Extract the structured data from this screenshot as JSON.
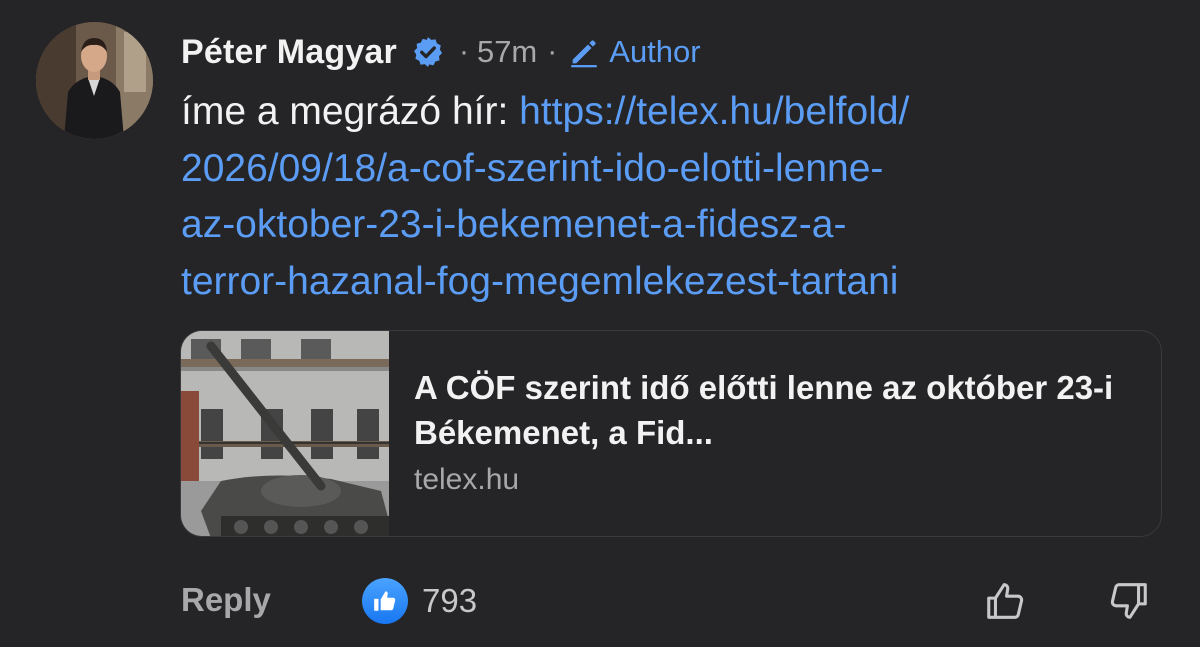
{
  "comment": {
    "author": "Péter Magyar",
    "verified": true,
    "time": "57m",
    "separator": "·",
    "badge_label": "Author",
    "text_prefix": "íme a megrázó hír: ",
    "link_lines": [
      "https://telex.hu/belfold/",
      "2026/09/18/a-cof-szerint-ido-elotti-lenne-",
      "az-oktober-23-i-bekemenet-a-fidesz-a-",
      "terror-hazanal-fog-megemlekezest-tartani"
    ]
  },
  "preview": {
    "title": "A CÖF szerint idő előtti lenne az október 23-i Békemenet, a Fid...",
    "domain": "telex.hu"
  },
  "actions": {
    "reply_label": "Reply",
    "like_count": "793"
  },
  "icons": {
    "verified": "verified-badge-icon",
    "author": "pencil-icon",
    "like": "thumbs-up-icon",
    "upvote": "thumbs-up-outline-icon",
    "downvote": "thumbs-down-outline-icon"
  },
  "colors": {
    "background": "#252527",
    "link": "#5b9cf5",
    "muted": "#a8a8ab",
    "like_badge": "#1877f2"
  }
}
